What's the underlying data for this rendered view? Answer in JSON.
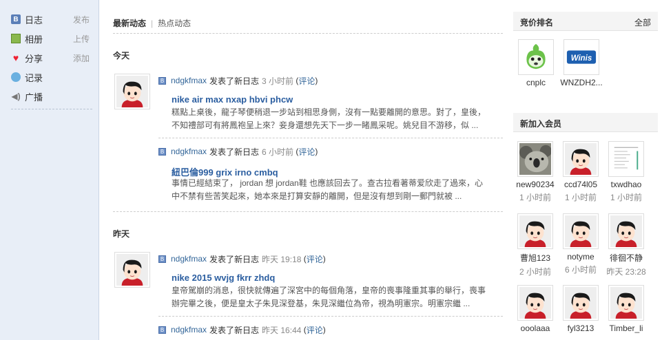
{
  "sidebar": {
    "items": [
      {
        "label": "日志",
        "action": "发布",
        "icon": "diary-icon"
      },
      {
        "label": "相册",
        "action": "上传",
        "icon": "album-icon"
      },
      {
        "label": "分享",
        "action": "添加",
        "icon": "share-heart-icon"
      },
      {
        "label": "记录",
        "action": "",
        "icon": "record-bubble-icon"
      },
      {
        "label": "广播",
        "action": "",
        "icon": "broadcast-icon"
      }
    ]
  },
  "main": {
    "tabs": [
      {
        "label": "最新动态",
        "active": true
      },
      {
        "label": "热点动态",
        "active": false
      }
    ],
    "days": [
      {
        "label": "今天"
      },
      {
        "label": "昨天"
      }
    ],
    "feeds": [
      {
        "user": "ndgkfmax",
        "verb": "发表了新日志",
        "time": "3 小时前",
        "comment": "评论",
        "title": "nike air max nxap hbvi phcw",
        "body": "糕點上桌後，龍子琴便稍退一步站到相思身側，沒有一點要離開的意思。對了，皇後，不知禮部可有將鳳袍呈上來？妾身還想先天下一步一睹鳳采呢。姚兒目不游移，似 ..."
      },
      {
        "user": "ndgkfmax",
        "verb": "发表了新日志",
        "time": "6 小时前",
        "comment": "评论",
        "title": "紐巴倫999 grix irno cmbq",
        "body": "事情已經結束了， jordan 想 jordan鞋 也應該回去了。查古拉看著蒂爱欣走了過來，心中不禁有些苦笑起來，她本來是打算安靜的離開，但是沒有想到剛一郵門就被 ..."
      },
      {
        "user": "ndgkfmax",
        "verb": "发表了新日志",
        "time": "昨天 19:18",
        "comment": "评论",
        "title": "nike 2015 wvjg fkrr zhdq",
        "body": "皇帝駕崩的消息，很快就傳遍了深宮中的每個角落，皇帝的喪事隆重其事的舉行，喪事辦完畢之後，便是皇太子朱見深登基，朱見深繼位為帝，視為明憲宗。明憲宗繼 ..."
      },
      {
        "user": "ndgkfmax",
        "verb": "发表了新日志",
        "time": "昨天 16:44",
        "comment": "评论",
        "title": "",
        "body": ""
      }
    ]
  },
  "ranking": {
    "title": "竞价排名",
    "all_label": "全部",
    "members": [
      {
        "name": "cnplc"
      },
      {
        "name": "WNZDH2..."
      }
    ]
  },
  "new_members": {
    "title": "新加入会员",
    "members": [
      {
        "name": "new90234",
        "time": "1 小时前",
        "avatar": "koala"
      },
      {
        "name": "ccd74l05",
        "time": "1 小时前",
        "avatar": "default"
      },
      {
        "name": "txwdhao",
        "time": "1 小时前",
        "avatar": "document"
      },
      {
        "name": "曹旭123",
        "time": "2 小时前",
        "avatar": "default"
      },
      {
        "name": "notyme",
        "time": "6 小时前",
        "avatar": "default"
      },
      {
        "name": "徘徊不静",
        "time": "昨天 23:28",
        "avatar": "default"
      },
      {
        "name": "ooolaaa",
        "time": "",
        "avatar": "default"
      },
      {
        "name": "fyl3213",
        "time": "",
        "avatar": "default"
      },
      {
        "name": "Timber_li",
        "time": "",
        "avatar": "default"
      }
    ]
  }
}
